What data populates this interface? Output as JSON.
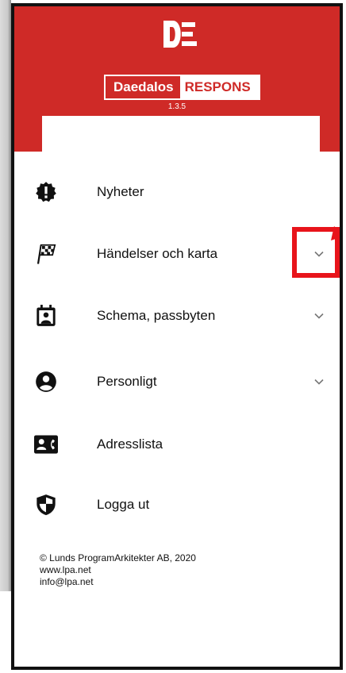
{
  "app": {
    "brand_left": "Daedalos",
    "brand_right": "RESPONS",
    "version": "1.3.5",
    "accent_color": "#cf2a27"
  },
  "menu": {
    "items": [
      {
        "label": "Nyheter",
        "icon": "alert-badge-icon",
        "expandable": false
      },
      {
        "label": "Händelser och karta",
        "icon": "checkered-flag-icon",
        "expandable": true
      },
      {
        "label": "Schema, passbyten",
        "icon": "calendar-user-icon",
        "expandable": true
      },
      {
        "label": "Personligt",
        "icon": "account-circle-icon",
        "expandable": true
      },
      {
        "label": "Adresslista",
        "icon": "contact-card-icon",
        "expandable": false
      },
      {
        "label": "Logga ut",
        "icon": "shield-icon",
        "expandable": false
      }
    ]
  },
  "footer": {
    "copyright": "© Lunds ProgramArkitekter AB, 2020",
    "website": "www.lpa.net",
    "email": "info@lpa.net"
  },
  "annotation": {
    "highlight_color": "#e8141b"
  }
}
